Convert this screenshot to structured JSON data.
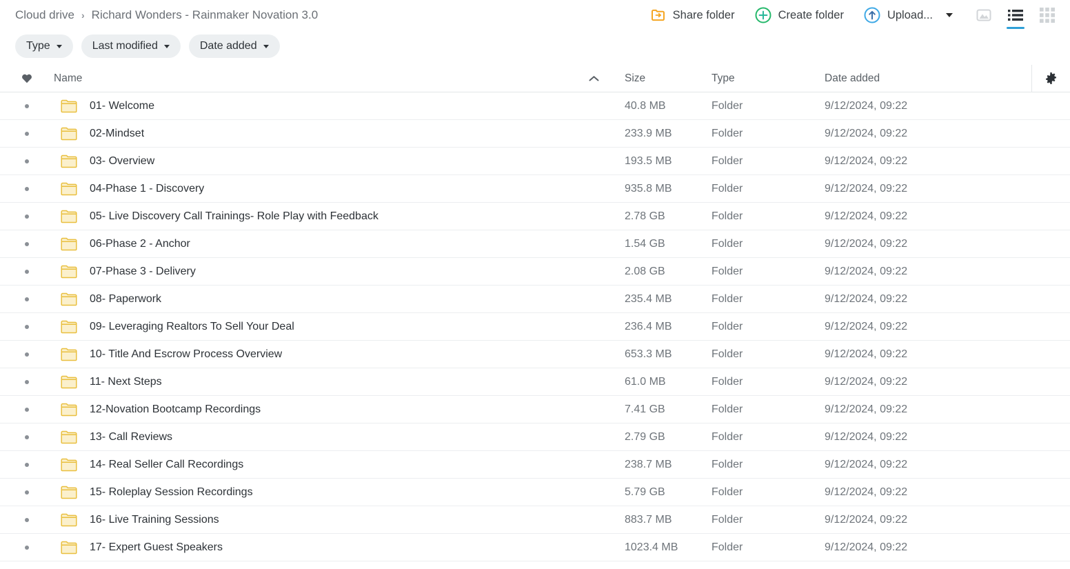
{
  "breadcrumb": {
    "root": "Cloud drive",
    "separator": "›",
    "current": "Richard Wonders - Rainmaker Novation 3.0"
  },
  "toolbar": {
    "share_label": "Share folder",
    "create_label": "Create folder",
    "upload_label": "Upload...",
    "share_icon": "share-folder-icon",
    "create_icon": "plus-circle-icon",
    "upload_icon": "upload-circle-icon",
    "upload_caret_icon": "chevron-down-icon",
    "view_gallery_icon": "gallery-view-icon",
    "view_list_icon": "list-view-icon",
    "view_grid_icon": "grid-view-icon",
    "active_view": "list"
  },
  "filters": [
    {
      "label": "Type",
      "icon": "chevron-down-icon"
    },
    {
      "label": "Last modified",
      "icon": "chevron-down-icon"
    },
    {
      "label": "Date added",
      "icon": "chevron-down-icon"
    }
  ],
  "table": {
    "headers": {
      "favorite_icon": "heart-icon",
      "name": "Name",
      "sort_icon": "chevron-up-icon",
      "size": "Size",
      "type": "Type",
      "date_added": "Date added",
      "settings_icon": "gear-icon"
    },
    "rows": [
      {
        "name": "01- Welcome",
        "size": "40.8 MB",
        "type": "Folder",
        "date_added": "9/12/2024, 09:22",
        "icon": "folder-icon"
      },
      {
        "name": "02-Mindset",
        "size": "233.9 MB",
        "type": "Folder",
        "date_added": "9/12/2024, 09:22",
        "icon": "folder-icon"
      },
      {
        "name": "03- Overview",
        "size": "193.5 MB",
        "type": "Folder",
        "date_added": "9/12/2024, 09:22",
        "icon": "folder-icon"
      },
      {
        "name": "04-Phase 1 - Discovery",
        "size": "935.8 MB",
        "type": "Folder",
        "date_added": "9/12/2024, 09:22",
        "icon": "folder-icon"
      },
      {
        "name": "05- Live Discovery Call Trainings- Role Play with Feedback",
        "size": "2.78 GB",
        "type": "Folder",
        "date_added": "9/12/2024, 09:22",
        "icon": "folder-icon"
      },
      {
        "name": "06-Phase 2 - Anchor",
        "size": "1.54 GB",
        "type": "Folder",
        "date_added": "9/12/2024, 09:22",
        "icon": "folder-icon"
      },
      {
        "name": "07-Phase 3 - Delivery",
        "size": "2.08 GB",
        "type": "Folder",
        "date_added": "9/12/2024, 09:22",
        "icon": "folder-icon"
      },
      {
        "name": "08- Paperwork",
        "size": "235.4 MB",
        "type": "Folder",
        "date_added": "9/12/2024, 09:22",
        "icon": "folder-icon"
      },
      {
        "name": "09- Leveraging Realtors To Sell Your Deal",
        "size": "236.4 MB",
        "type": "Folder",
        "date_added": "9/12/2024, 09:22",
        "icon": "folder-icon"
      },
      {
        "name": "10- Title And Escrow Process Overview",
        "size": "653.3 MB",
        "type": "Folder",
        "date_added": "9/12/2024, 09:22",
        "icon": "folder-icon"
      },
      {
        "name": "11- Next Steps",
        "size": "61.0 MB",
        "type": "Folder",
        "date_added": "9/12/2024, 09:22",
        "icon": "folder-icon"
      },
      {
        "name": "12-Novation Bootcamp Recordings",
        "size": "7.41 GB",
        "type": "Folder",
        "date_added": "9/12/2024, 09:22",
        "icon": "folder-icon"
      },
      {
        "name": "13- Call Reviews",
        "size": "2.79 GB",
        "type": "Folder",
        "date_added": "9/12/2024, 09:22",
        "icon": "folder-icon"
      },
      {
        "name": "14- Real Seller Call Recordings",
        "size": "238.7 MB",
        "type": "Folder",
        "date_added": "9/12/2024, 09:22",
        "icon": "folder-icon"
      },
      {
        "name": "15- Roleplay Session Recordings",
        "size": "5.79 GB",
        "type": "Folder",
        "date_added": "9/12/2024, 09:22",
        "icon": "folder-icon"
      },
      {
        "name": "16- Live Training Sessions",
        "size": "883.7 MB",
        "type": "Folder",
        "date_added": "9/12/2024, 09:22",
        "icon": "folder-icon"
      },
      {
        "name": "17- Expert Guest Speakers",
        "size": "1023.4 MB",
        "type": "Folder",
        "date_added": "9/12/2024, 09:22",
        "icon": "folder-icon"
      }
    ]
  },
  "colors": {
    "folder_yellow": "#f3d37a",
    "share_orange": "#f5a623",
    "create_green": "#25b86b",
    "upload_blue": "#3fa9e6",
    "active_underline": "#2fa0d8"
  }
}
